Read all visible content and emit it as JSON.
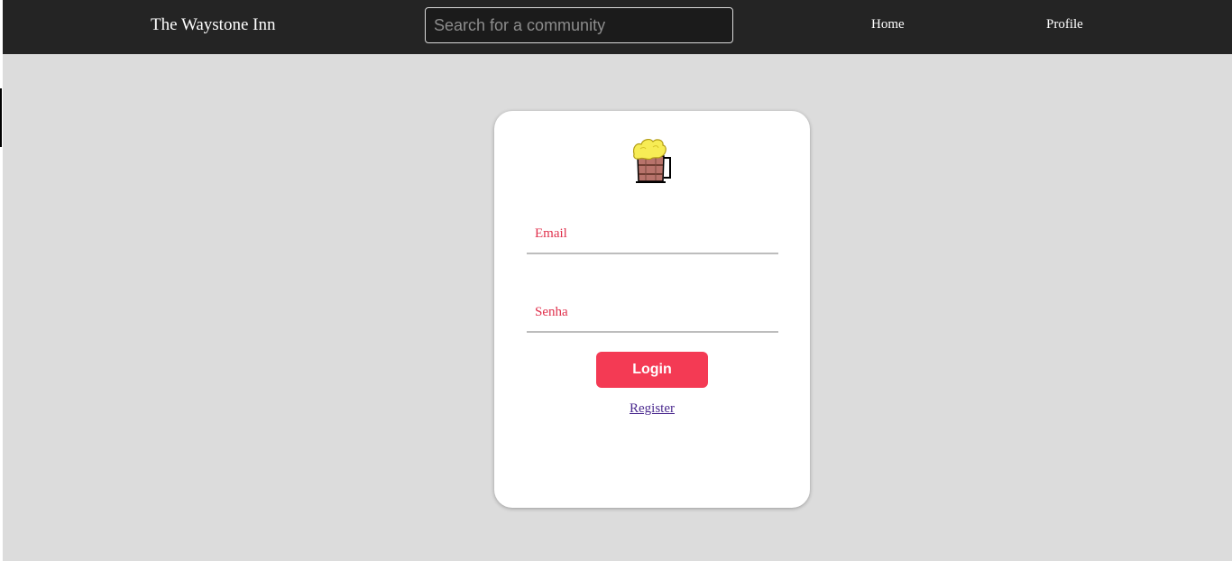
{
  "header": {
    "brand": "The Waystone Inn",
    "search": {
      "placeholder": "Search for a community",
      "value": ""
    },
    "nav": {
      "home": "Home",
      "profile": "Profile"
    }
  },
  "login": {
    "logo_icon": "beer-mug-icon",
    "email_placeholder": "Email",
    "password_placeholder": "Senha",
    "login_label": "Login",
    "register_label": "Register"
  },
  "colors": {
    "navbar": "#242424",
    "background": "#dcdcdc",
    "accent": "#f43a54",
    "placeholder": "#e0304c",
    "link": "#4b2a8f"
  }
}
